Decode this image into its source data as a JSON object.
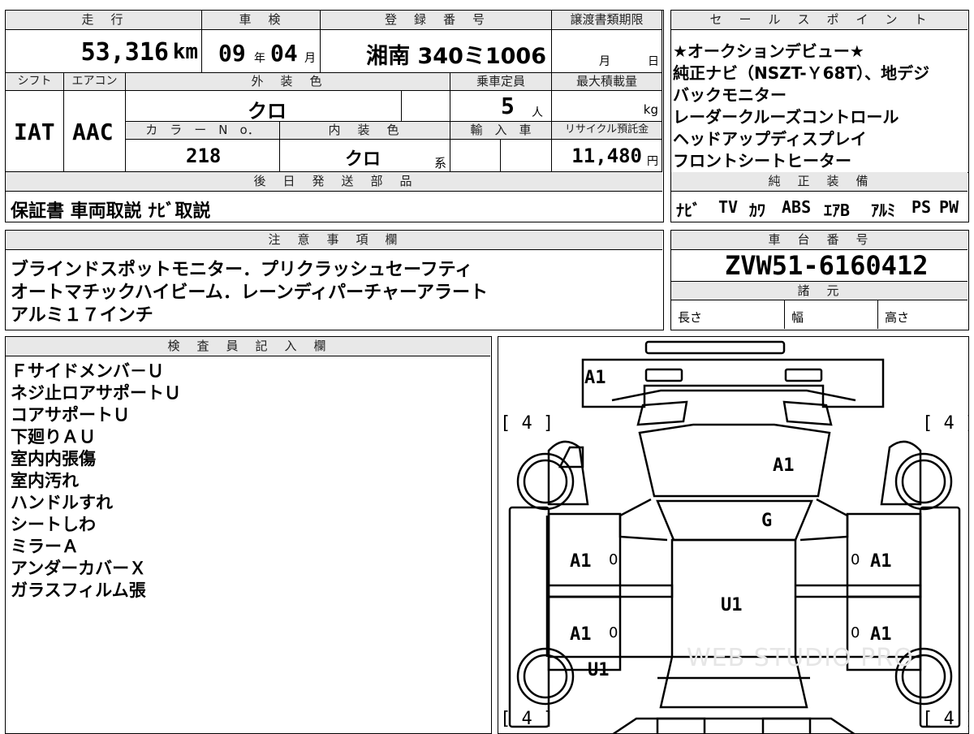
{
  "spec": {
    "headers": {
      "mileage": "走　行",
      "inspection": "車　検",
      "reg_number": "登　録　番　号",
      "transfer_deadline": "譲渡書類期限",
      "shift": "シフト",
      "aircon": "エアコン",
      "exterior_color": "外　装　色",
      "capacity": "乗車定員",
      "max_load": "最大積載量",
      "color_no": "カ　ラ　ー　N　o．",
      "interior_color": "内　装　色",
      "import": "輸　入　車",
      "recycle_fee": "リサイクル預託金",
      "later_parts": "後　日　発　送　部　品"
    },
    "mileage_value": "53,316",
    "mileage_unit": "km",
    "inspection_year": "09",
    "year_unit": "年",
    "inspection_month": "04",
    "month_unit": "月",
    "reg_number_value": "湘南 340ミ1006",
    "deadline_month_unit": "月",
    "deadline_day_unit": "日",
    "shift_value": "IAT",
    "aircon_value": "AAC",
    "exterior_color_value": "クロ",
    "capacity_value": "5",
    "capacity_unit": "人",
    "max_load_unit": "kg",
    "color_no_value": "218",
    "interior_color_value": "クロ",
    "interior_suffix": "系",
    "recycle_value": "11,480",
    "recycle_unit": "円",
    "later_parts_value": "保証書 車両取説 ﾅﾋﾞ取説"
  },
  "sales_points": {
    "header": "セ　ー　ル　ス　ポ　イ　ン　ト",
    "lines": [
      "★オークションデビュー★",
      "純正ナビ（NSZT-Ｙ68T）、地デジ",
      "バックモニター",
      "レーダークルーズコントロール",
      "ヘッドアップディスプレイ",
      "フロントシートヒーター"
    ]
  },
  "equipment": {
    "header": "純　正　装　備",
    "items": [
      "ﾅﾋﾞ",
      "TV",
      "ｶﾜ",
      "ABS",
      "ｴｱB",
      "ｱﾙﾐ",
      "PS",
      "PW"
    ]
  },
  "notes": {
    "header": "注　意　事　項　欄",
    "lines": [
      "ブラインドスポットモニター．プリクラッシュセーフティ",
      "オートマチックハイビーム．レーンディパーチャーアラート",
      "アルミ１７インチ"
    ]
  },
  "chassis": {
    "header": "車　台　番　号",
    "value": "ZVW51-6160412"
  },
  "specs": {
    "header": "諸　元",
    "length": "長さ",
    "width": "幅",
    "height": "高さ"
  },
  "inspector": {
    "header": "検　査　員　記　入　欄",
    "lines": [
      "Ｆサイドメンバ－Ｕ",
      "ネジ止ロアサポートＵ",
      "コアサポートＵ",
      "下廻りＡＵ",
      "室内内張傷",
      "室内汚れ",
      "ハンドルすれ",
      "シートしわ",
      "ミラーＡ",
      "アンダーカバーＸ",
      "ガラスフィルム張"
    ]
  },
  "diagram": {
    "labels": {
      "front_bumper": "A1",
      "hood": "A1",
      "windshield": "G",
      "front_left_door": "A1",
      "front_right_door": "A1",
      "rear_left_door": "A1",
      "rear_right_door": "A1",
      "roof": "U1",
      "rear_left_wheel": "U1"
    },
    "tires": [
      "[ 4 ]",
      "[ 4 ]",
      "[ 4 ]",
      "[ 4 ]"
    ],
    "zero": "0",
    "watermark": "WEB STUDIO PRO"
  }
}
